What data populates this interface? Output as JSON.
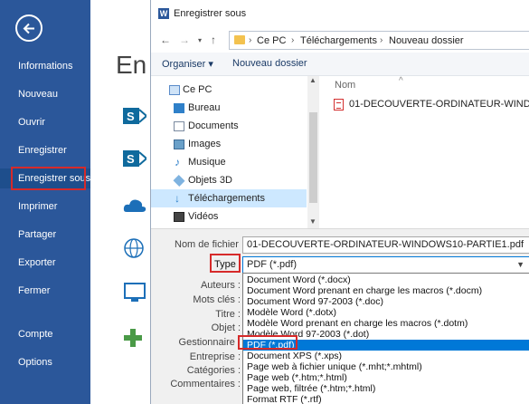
{
  "sidebar": {
    "items": [
      {
        "label": "Informations"
      },
      {
        "label": "Nouveau"
      },
      {
        "label": "Ouvrir"
      },
      {
        "label": "Enregistrer"
      },
      {
        "label": "Enregistrer sous"
      },
      {
        "label": "Imprimer"
      },
      {
        "label": "Partager"
      },
      {
        "label": "Exporter"
      },
      {
        "label": "Fermer"
      },
      {
        "label": "Compte"
      },
      {
        "label": "Options"
      }
    ],
    "accent": "#2b579a",
    "highlight_color": "#d62a2a"
  },
  "backstage": {
    "title": "En"
  },
  "dialog": {
    "title": "Enregistrer sous",
    "breadcrumb": [
      "Ce PC",
      "Téléchargements",
      "Nouveau dossier"
    ],
    "toolbar": {
      "organize": "Organiser ▾",
      "new_folder": "Nouveau dossier"
    },
    "nav_items": [
      {
        "label": "Ce PC",
        "icon": "computer-icon"
      },
      {
        "label": "Bureau",
        "icon": "desktop-icon"
      },
      {
        "label": "Documents",
        "icon": "documents-icon"
      },
      {
        "label": "Images",
        "icon": "images-icon"
      },
      {
        "label": "Musique",
        "icon": "music-icon"
      },
      {
        "label": "Objets 3D",
        "icon": "objects-3d-icon"
      },
      {
        "label": "Téléchargements",
        "icon": "downloads-icon"
      },
      {
        "label": "Vidéos",
        "icon": "videos-icon"
      }
    ],
    "column_header": "Nom",
    "file_name": "01-DECOUVERTE-ORDINATEUR-WINDO...",
    "form": {
      "filename_label": "Nom de fichier :",
      "filename_value": "01-DECOUVERTE-ORDINATEUR-WINDOWS10-PARTIE1.pdf",
      "type_label": "Type :",
      "type_value": "PDF (*.pdf)",
      "meta_labels": [
        "Auteurs :",
        "Mots clés :",
        "Titre :",
        "Objet :",
        "Gestionnaire :",
        "Entreprise :",
        "Catégories :",
        "Commentaires :"
      ],
      "type_options": [
        "Document Word (*.docx)",
        "Document Word prenant en charge les macros (*.docm)",
        "Document Word 97-2003 (*.doc)",
        "Modèle Word (*.dotx)",
        "Modèle Word prenant en charge les macros (*.dotm)",
        "Modèle Word 97-2003 (*.dot)",
        "PDF (*.pdf)",
        "Document XPS (*.xps)",
        "Page web à fichier unique (*.mht;*.mhtml)",
        "Page web (*.htm;*.html)",
        "Page web, filtrée (*.htm;*.html)",
        "Format RTF (*.rtf)"
      ],
      "selected_option": "PDF (*.pdf)"
    }
  }
}
